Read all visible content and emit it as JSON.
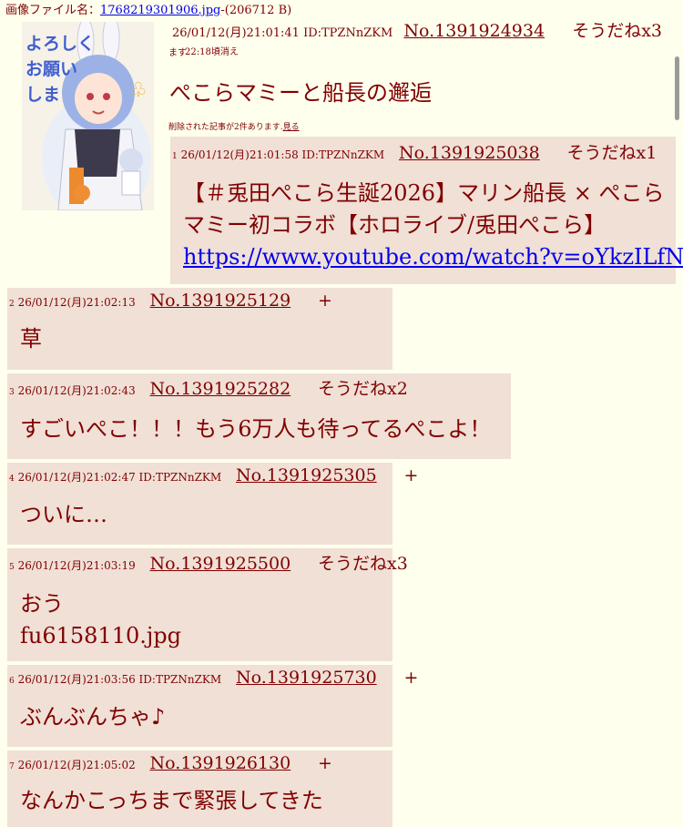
{
  "file": {
    "label": "画像ファイル名：",
    "name": "1768219301906.jpg",
    "size": "-(206712 B)"
  },
  "op": {
    "datetime": "26/01/12(月)21:01:41",
    "id": "ID:TPZNnZKM",
    "no": "No.1391924934",
    "sodane": "そうだねx3",
    "expire": "22:18頃消え",
    "expire_tail": "ます",
    "title": "ぺこらマミーと船長の邂逅",
    "deleted_note": "削除された記事が2件あります.",
    "see_link": "見る"
  },
  "replies": [
    {
      "num": "1",
      "datetime": "26/01/12(月)21:01:58",
      "id": "ID:TPZNnZKM",
      "no": "No.1391925038",
      "sodane": "そうだねx1",
      "lines": [
        "【＃兎田ぺこら生誕2026】マリン船長 × ぺこら",
        "マミー初コラボ【ホロライブ/兎田ぺこら】"
      ],
      "link": "https://www.youtube.com/watch?v=oYkzILfNoHw"
    },
    {
      "num": "2",
      "datetime": "26/01/12(月)21:02:13",
      "id": "",
      "no": "No.1391925129",
      "sodane": "+",
      "lines": [
        "草"
      ]
    },
    {
      "num": "3",
      "datetime": "26/01/12(月)21:02:43",
      "id": "",
      "no": "No.1391925282",
      "sodane": "そうだねx2",
      "lines": [
        "すごいぺこ！！！もう6万人も待ってるぺこよ！"
      ]
    },
    {
      "num": "4",
      "datetime": "26/01/12(月)21:02:47",
      "id": "ID:TPZNnZKM",
      "no": "No.1391925305",
      "sodane": "+",
      "lines": [
        "ついに…"
      ]
    },
    {
      "num": "5",
      "datetime": "26/01/12(月)21:03:19",
      "id": "",
      "no": "No.1391925500",
      "sodane": "そうだねx3",
      "lines": [
        "おう",
        "fu6158110.jpg"
      ]
    },
    {
      "num": "6",
      "datetime": "26/01/12(月)21:03:56",
      "id": "ID:TPZNnZKM",
      "no": "No.1391925730",
      "sodane": "+",
      "lines": [
        "ぶんぶんちゃ♪"
      ]
    },
    {
      "num": "7",
      "datetime": "26/01/12(月)21:05:02",
      "id": "",
      "no": "No.1391926130",
      "sodane": "+",
      "lines": [
        "なんかこっちまで緊張してきた"
      ]
    }
  ],
  "thumbnail": {
    "text_lines": [
      "よろしく",
      "お願い",
      "しま"
    ],
    "icon": "bunny-girl-illustration"
  },
  "colors": {
    "background": "#ffffee",
    "reply_background": "#f0e0d6",
    "text": "#800000",
    "link": "#0000ee"
  }
}
